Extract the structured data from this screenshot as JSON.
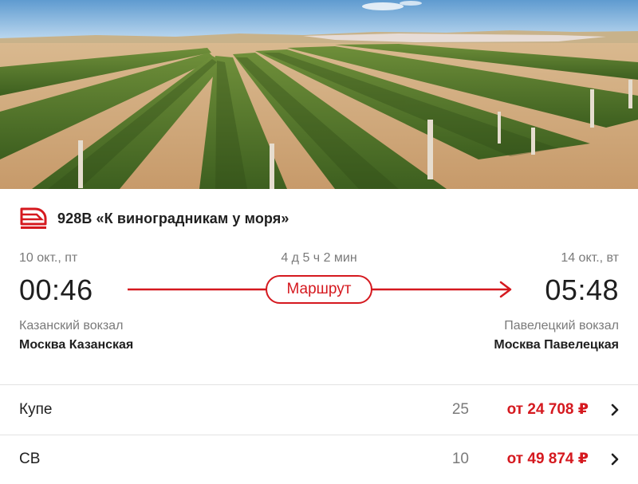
{
  "train": {
    "icon": "train-icon",
    "name": "928В «К виноградникам у моря»"
  },
  "departure": {
    "date": "10 окт., пт",
    "time": "00:46",
    "station_hint": "Казанский вокзал",
    "station": "Москва Казанская"
  },
  "arrival": {
    "date": "14 окт., вт",
    "time": "05:48",
    "station_hint": "Павелецкий вокзал",
    "station": "Москва Павелецкая"
  },
  "route": {
    "duration": "4 д 5 ч 2 мин",
    "button_label": "Маршрут"
  },
  "classes": [
    {
      "name": "Купе",
      "seats": "25",
      "price": "от 24 708 ₽",
      "icon": "chevron-right-icon"
    },
    {
      "name": "СВ",
      "seats": "10",
      "price": "от 49 874 ₽",
      "icon": "chevron-right-icon"
    }
  ],
  "colors": {
    "accent": "#d5191f",
    "text": "#1f1f1f",
    "muted": "#7a7a7a"
  }
}
